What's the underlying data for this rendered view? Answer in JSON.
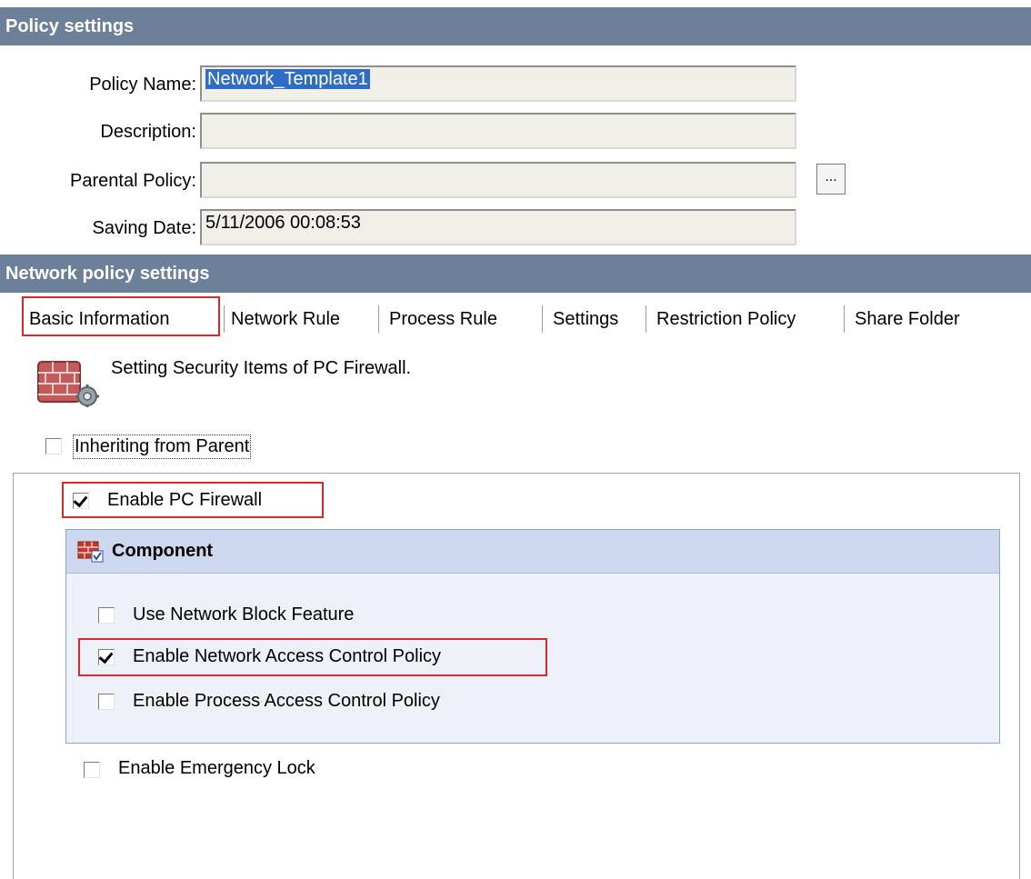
{
  "policy_settings": {
    "title": "Policy settings",
    "fields": {
      "policy_name": {
        "label": "Policy Name:",
        "value": "Network_Template1"
      },
      "description": {
        "label": "Description:",
        "value": ""
      },
      "parental_policy": {
        "label": "Parental Policy:",
        "value": "",
        "browse_label": "..."
      },
      "saving_date": {
        "label": "Saving Date:",
        "value": "5/11/2006 00:08:53"
      }
    }
  },
  "network_policy": {
    "title": "Network policy settings",
    "tabs": [
      {
        "label": "Basic Information",
        "active": true
      },
      {
        "label": "Network Rule"
      },
      {
        "label": "Process Rule"
      },
      {
        "label": "Settings"
      },
      {
        "label": "Restriction Policy"
      },
      {
        "label": "Share Folder"
      }
    ]
  },
  "basic_info": {
    "description": "Setting Security Items of PC Firewall.",
    "icon": "firewall-settings-icon",
    "inherit": {
      "label": "Inheriting from Parent",
      "checked": false
    },
    "enable_firewall": {
      "label": "Enable PC Firewall",
      "checked": true
    },
    "component": {
      "title": "Component",
      "icon": "firewall-component-icon",
      "items": [
        {
          "label": "Use Network Block Feature",
          "checked": false
        },
        {
          "label": "Enable Network Access Control Policy",
          "checked": true
        },
        {
          "label": "Enable Process Access Control Policy",
          "checked": false
        }
      ]
    },
    "emergency_lock": {
      "label": "Enable Emergency Lock",
      "checked": false
    }
  },
  "colors": {
    "header_bar": "#6d8099",
    "highlight": "#e0262a",
    "selection": "#2f6cc6",
    "component_header": "#cdd8ef"
  }
}
